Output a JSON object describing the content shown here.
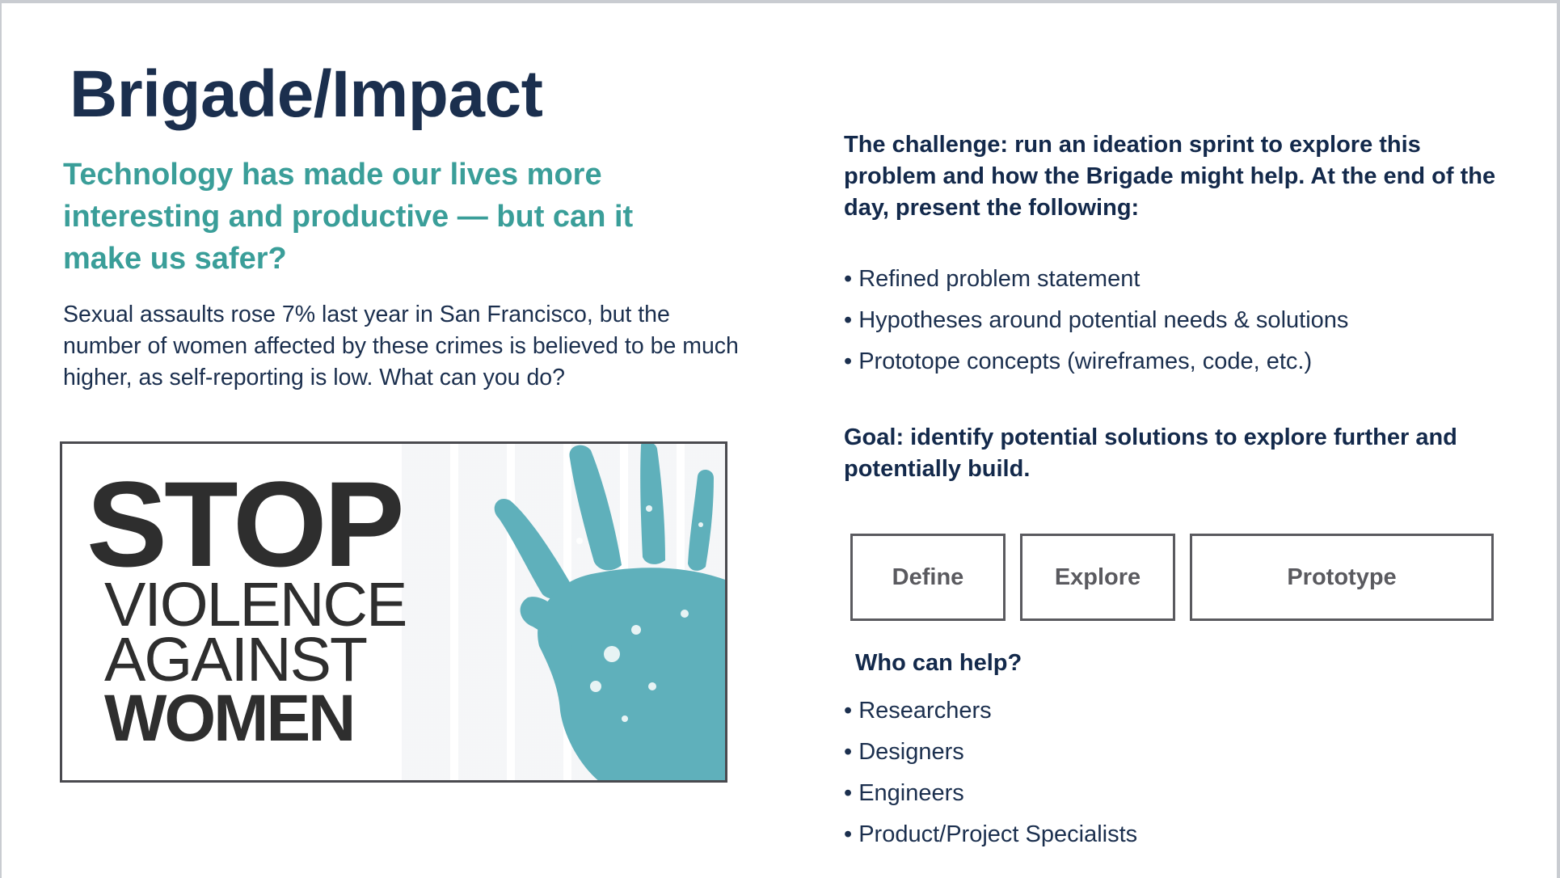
{
  "slide": {
    "title": "Brigade/Impact",
    "subtitle": "Technology has made our lives more interesting and productive — but can it make us safer?",
    "body": "Sexual assaults rose 7% last year in San Francisco, but the number of women affected by these crimes is believed to be much higher, as self-reporting is low. What can you do?"
  },
  "poster": {
    "line1": "STOP",
    "line2": "VIOLENCE",
    "line3": "AGAINST",
    "line4": "WOMEN",
    "hand_color": "#5fb0bb"
  },
  "challenge": {
    "text": "The challenge: run an ideation sprint to explore this problem and how the Brigade might help. At the end of the day, present the following:",
    "items": [
      "• Refined problem statement",
      "• Hypotheses around potential needs & solutions",
      "• Prototope concepts (wireframes, code, etc.)"
    ]
  },
  "goal": "Goal: identify potential solutions to explore further and potentially build.",
  "phases": [
    "Define",
    "Explore",
    "Prototype"
  ],
  "helpers": {
    "heading": "Who can help?",
    "items": [
      "• Researchers",
      "• Designers",
      "• Engineers",
      "• Product/Project Specialists"
    ]
  }
}
